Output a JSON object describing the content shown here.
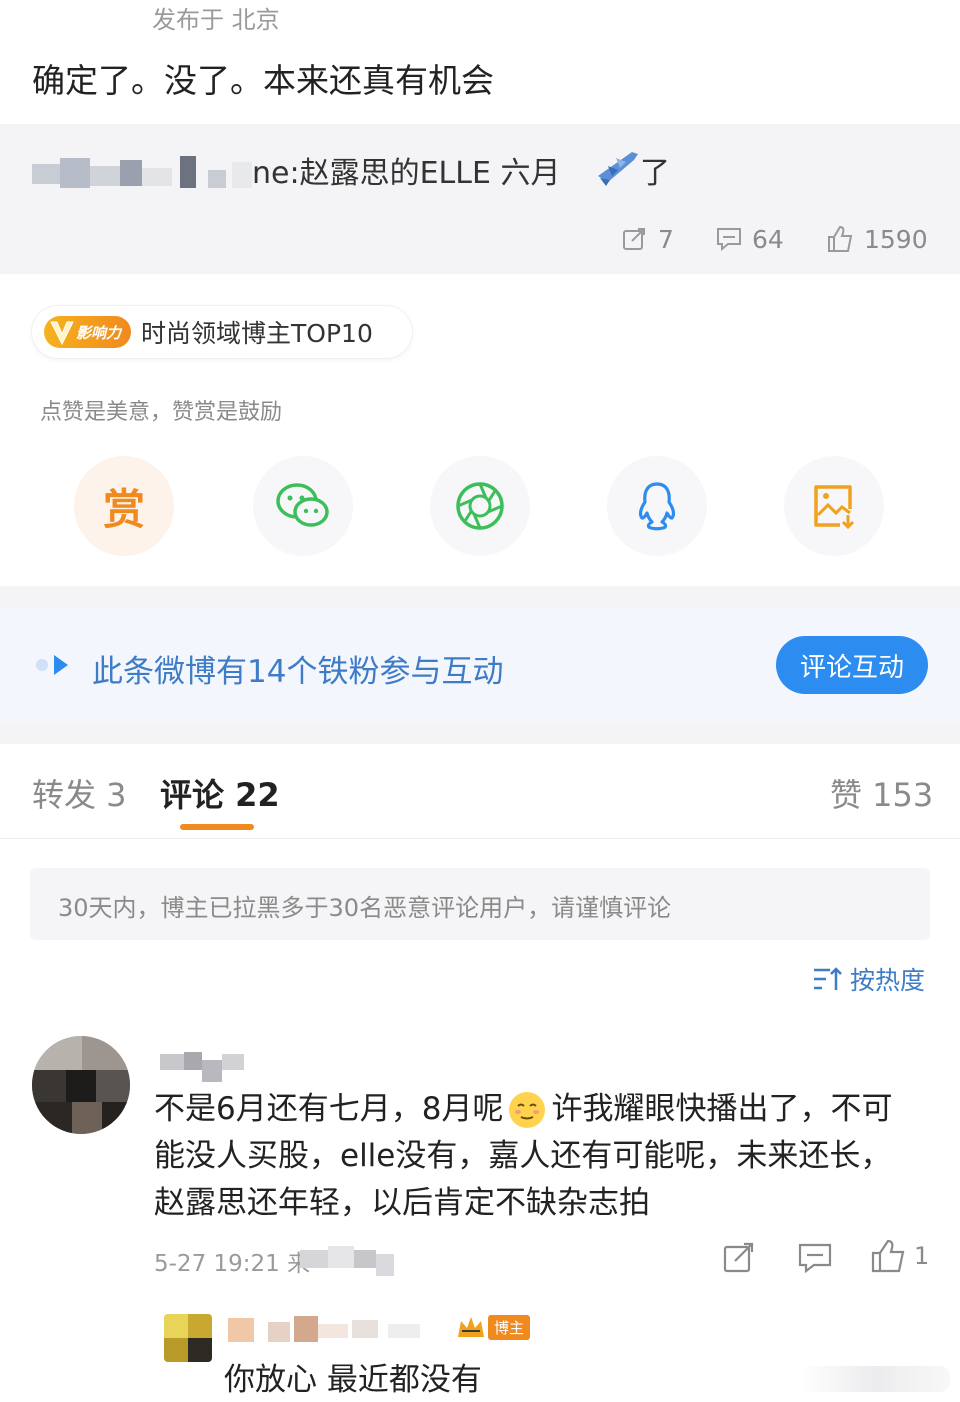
{
  "post": {
    "location": "发布于 北京",
    "text": "确定了。没了。本来还真有机会"
  },
  "quote": {
    "text_tail": "ne:赵露思的ELLE 六月",
    "text_end": "了",
    "emoji": "airplane-emoji",
    "stats": {
      "reposts": "7",
      "comments": "64",
      "likes": "1590"
    }
  },
  "badge": {
    "tag": "影响力",
    "label": "时尚领域博主TOP10"
  },
  "reward": {
    "caption": "点赞是美意，赞赏是鼓励",
    "reward_glyph": "赏",
    "actions": [
      "reward-icon",
      "wechat-icon",
      "moments-icon",
      "qq-icon",
      "save-image-icon"
    ]
  },
  "fans_banner": {
    "text": "此条微博有14个铁粉参与互动",
    "button": "评论互动"
  },
  "tabs": {
    "repost": "转发 3",
    "comment": "评论 22",
    "like": "赞 153"
  },
  "notice": "30天内，博主已拉黑多于30名恶意评论用户，请谨慎评论",
  "sort": {
    "label": "按热度"
  },
  "comment": {
    "line1a": "不是6月还有七月，8月呢",
    "line1b": "许我耀眼快播出了，不可",
    "line2": "能没人买股，elle没有，嘉人还有可能呢，未来还长，",
    "line3": "赵露思还年轻，以后肯定不缺杂志拍",
    "time": "5-27 19:21 来",
    "like_count": "1"
  },
  "reply": {
    "author_badge": "博主",
    "text": "你放心 最近都没有"
  },
  "colors": {
    "accent_orange": "#f08a1e",
    "link_blue": "#3f7cc7",
    "button_blue": "#2d8cf0",
    "green": "#3cbf5a"
  }
}
